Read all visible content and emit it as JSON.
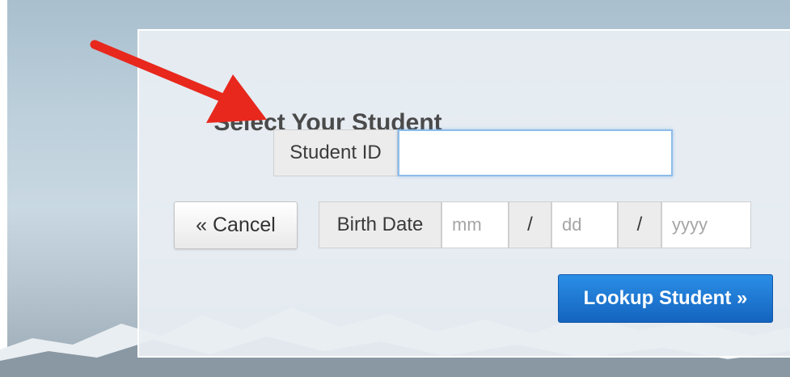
{
  "form": {
    "title": "Select Your Student",
    "student_id_label": "Student ID",
    "student_id_value": "",
    "birth_date_label": "Birth Date",
    "month_placeholder": "mm",
    "day_placeholder": "dd",
    "year_placeholder": "yyyy",
    "separator": "/",
    "cancel_label": "« Cancel",
    "lookup_label": "Lookup Student »"
  },
  "colors": {
    "primary_button": "#1f78d6",
    "arrow": "#e8281d",
    "focus_border": "#8ebde9"
  },
  "annotation": {
    "icon": "red-arrow-icon"
  }
}
